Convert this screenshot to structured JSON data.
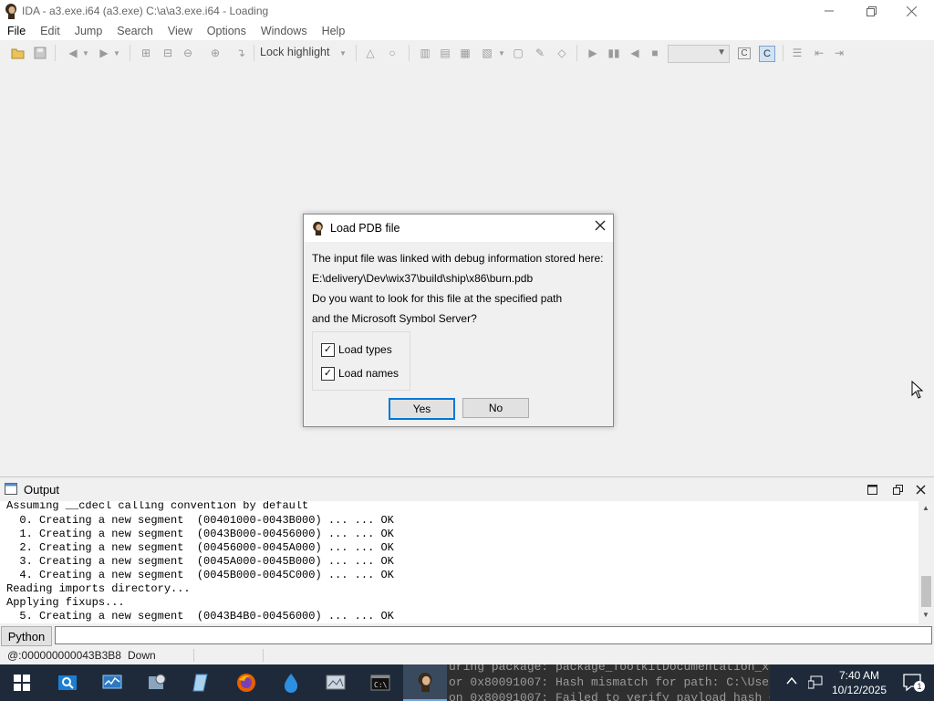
{
  "window": {
    "title": "IDA - a3.exe.i64 (a3.exe) C:\\a\\a3.exe.i64 - Loading"
  },
  "menu": [
    "File",
    "Edit",
    "Jump",
    "Search",
    "View",
    "Options",
    "Windows",
    "Help"
  ],
  "toolbar": {
    "lock_highlight": "Lock highlight"
  },
  "dialog": {
    "title": "Load PDB file",
    "line1": "The input file was linked with debug information stored here:",
    "line2": "E:\\delivery\\Dev\\wix37\\build\\ship\\x86\\burn.pdb",
    "line3": "Do you want to look for this file at the specified path",
    "line4": "and the Microsoft Symbol Server?",
    "checkbox_types": "Load types",
    "checkbox_names": "Load names",
    "checkbox_types_checked": true,
    "checkbox_names_checked": true,
    "yes": "Yes",
    "no": "No"
  },
  "output": {
    "title": "Output",
    "lines": [
      "Assuming __cdecl calling convention by default",
      "  0. Creating a new segment  (00401000-0043B000) ... ... OK",
      "  1. Creating a new segment  (0043B000-00456000) ... ... OK",
      "  2. Creating a new segment  (00456000-0045A000) ... ... OK",
      "  3. Creating a new segment  (0045A000-0045B000) ... ... OK",
      "  4. Creating a new segment  (0045B000-0045C000) ... ... OK",
      "Reading imports directory...",
      "Applying fixups...",
      "  5. Creating a new segment  (0043B4B0-00456000) ... ... OK"
    ]
  },
  "python": {
    "button": "Python",
    "input_value": ""
  },
  "status": {
    "address": "@:000000000043B3B8",
    "direction": "Down"
  },
  "taskbar": {
    "time": "7:40 AM",
    "date": "10/12/2025",
    "notification_count": "1",
    "background_text": [
      "uring package: package_ToolkitDocumentation_xde_en_...load:",
      "or 0x80091007: Hash mismatch for path: C:\\User",
      "on 0x80091007: Failed to verify payload hash C:\\Users"
    ]
  }
}
